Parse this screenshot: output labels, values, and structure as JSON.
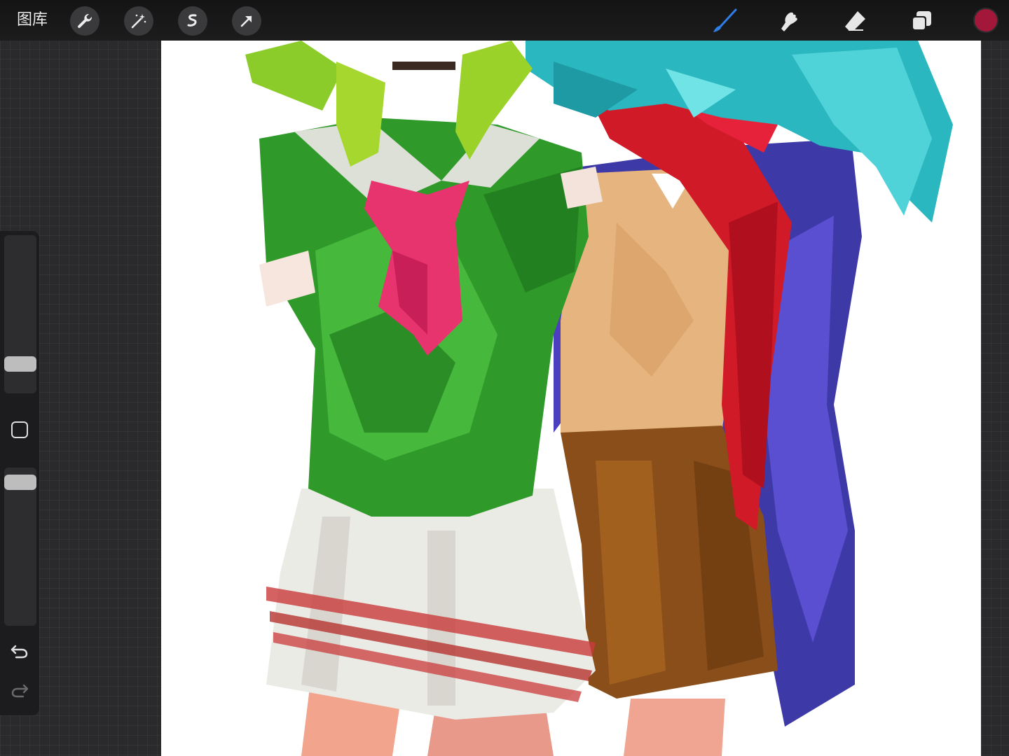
{
  "toolbar": {
    "gallery_label": "图库",
    "tools_left": [
      "wrench-icon",
      "magic-wand-icon",
      "selection-icon",
      "transform-arrow-icon"
    ],
    "tools_right": [
      "brush-icon",
      "smudge-icon",
      "eraser-icon",
      "layers-icon"
    ],
    "active_tool": "brush-icon",
    "active_color": "#a3173a",
    "brush_accent": "#2f7de6"
  },
  "sidebar": {
    "brush_size_level": 0.15,
    "opacity_level": 0.95,
    "buttons": [
      "modifier-square",
      "undo-icon",
      "redo-icon"
    ]
  }
}
